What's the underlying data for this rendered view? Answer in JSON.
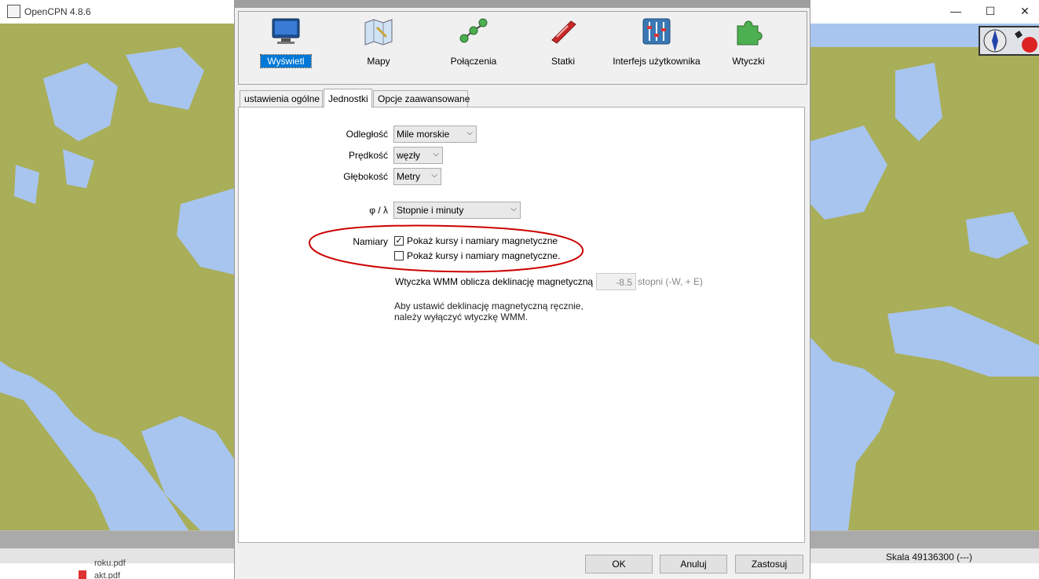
{
  "app": {
    "title": "OpenCPN 4.8.6"
  },
  "window_controls": {
    "minimize": "—",
    "maximize": "☐",
    "close": "✕"
  },
  "status": {
    "scale": "Skala 49136300 (---)"
  },
  "background_files": [
    "roku.pdf",
    "akt.pdf"
  ],
  "colors": {
    "land": "#a9ae58",
    "water": "#a8c5ef",
    "accent": "#0078d7",
    "annotation": "#cc0000"
  },
  "dialog": {
    "categories": [
      {
        "label": "Wyświetl",
        "icon": "monitor-icon",
        "selected": true
      },
      {
        "label": "Mapy",
        "icon": "map-icon"
      },
      {
        "label": "Połączenia",
        "icon": "connections-icon"
      },
      {
        "label": "Statki",
        "icon": "ship-icon"
      },
      {
        "label": "Interfejs użytkownika",
        "icon": "sliders-icon"
      },
      {
        "label": "Wtyczki",
        "icon": "puzzle-icon"
      }
    ],
    "tabs": [
      {
        "label": "ustawienia ogólne"
      },
      {
        "label": "Jednostki",
        "active": true
      },
      {
        "label": "Opcje zaawansowane"
      }
    ],
    "units": {
      "distance_label": "Odległość",
      "distance_value": "Mile morskie",
      "speed_label": "Prędkość",
      "speed_value": "węzły",
      "depth_label": "Głębokość",
      "depth_value": "Metry",
      "latlon_label": "φ / λ",
      "latlon_value": "Stopnie i minuty",
      "bearings_label": "Namiary",
      "bearings_check1": "Pokaż kursy i namiary magnetyczne",
      "bearings_check1_checked": true,
      "bearings_check2": "Pokaż kursy i namiary magnetyczne.",
      "bearings_check2_checked": false,
      "wmm_label": "Wtyczka WMM oblicza deklinację magnetyczną",
      "declination_value": "-8.5",
      "declination_units": "stopni (-W, + E)",
      "note_line1": "Aby ustawić deklinację magnetyczną ręcznie,",
      "note_line2": "należy wyłączyć wtyczkę WMM."
    },
    "buttons": {
      "ok": "OK",
      "cancel": "Anuluj",
      "apply": "Zastosuj"
    }
  }
}
